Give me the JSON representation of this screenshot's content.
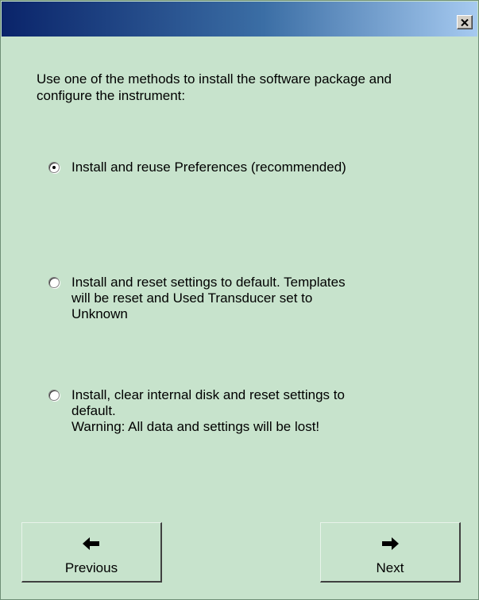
{
  "window": {
    "title": ""
  },
  "intro_text": "Use one of the methods to install the software package and configure the instrument:",
  "options": [
    {
      "label": "Install and reuse Preferences (recommended)",
      "selected": true
    },
    {
      "label": "Install and reset settings to default. Templates\nwill be reset and Used Transducer set to\nUnknown",
      "selected": false
    },
    {
      "label": "Install, clear internal disk and reset settings to\ndefault.\nWarning: All data and settings will be lost!",
      "selected": false
    }
  ],
  "buttons": {
    "previous_label": "Previous",
    "previous_icon": "arrow-left-icon",
    "next_label": "Next",
    "next_icon": "arrow-right-icon",
    "close_icon": "close-icon"
  },
  "colors": {
    "background": "#c7e3cc",
    "titlebar_start": "#0a246a",
    "titlebar_end": "#a6caf0"
  }
}
